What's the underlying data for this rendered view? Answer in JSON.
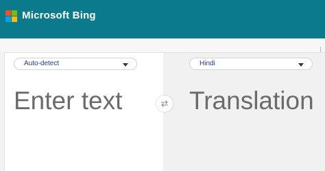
{
  "header": {
    "brand_label": "Microsoft Bing",
    "color": "#0a7a8c",
    "logo_icon": "microsoft-logo-icon"
  },
  "source": {
    "language": "Auto-detect",
    "placeholder": "Enter text"
  },
  "target": {
    "language": "Hindi",
    "placeholder": "Translation"
  },
  "swap": {
    "icon": "swap-arrows-icon"
  }
}
